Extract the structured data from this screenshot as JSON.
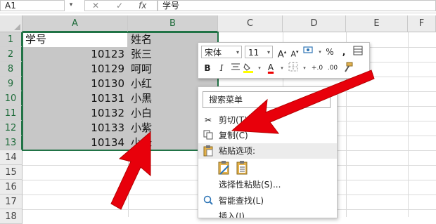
{
  "formula_bar": {
    "name_box": "A1",
    "cancel_symbol": "✕",
    "enter_symbol": "✓",
    "fx_symbol": "fx",
    "formula_value": "学号"
  },
  "grid": {
    "columns": [
      "A",
      "B",
      "C",
      "D",
      "E",
      "F"
    ],
    "rows": [
      "1",
      "2",
      "8",
      "9",
      "10",
      "11",
      "12",
      "13",
      "14",
      "15",
      "16",
      "17",
      "18"
    ],
    "cells": [
      {
        "a": "学号",
        "b": "姓名"
      },
      {
        "a": "10123",
        "b": "张三"
      },
      {
        "a": "10129",
        "b": "呵呵"
      },
      {
        "a": "10130",
        "b": "小红"
      },
      {
        "a": "10131",
        "b": "小黑"
      },
      {
        "a": "10132",
        "b": "小白"
      },
      {
        "a": "10133",
        "b": "小紫"
      },
      {
        "a": "10134",
        "b": "小绿"
      }
    ]
  },
  "mini_toolbar": {
    "font_name": "宋体",
    "font_size": "11",
    "grow_font": "A",
    "shrink_font": "A",
    "percent": "%",
    "comma": ",",
    "bold": "B",
    "italic": "I",
    "font_color_letter": "A",
    "inc_decimal": "+.0",
    "dec_decimal": ".00"
  },
  "context_menu": {
    "search_placeholder": "搜索菜单",
    "cut": "剪切(T)",
    "copy": "复制(C)",
    "paste_options": "粘贴选项:",
    "paste_special": "选择性粘贴(S)...",
    "smart_lookup": "智能查找(L)",
    "insert": "插入(I)..."
  },
  "colors": {
    "excel_green": "#217346",
    "selection_gray": "#c7c7c7",
    "arrow_red": "#e8000b"
  }
}
